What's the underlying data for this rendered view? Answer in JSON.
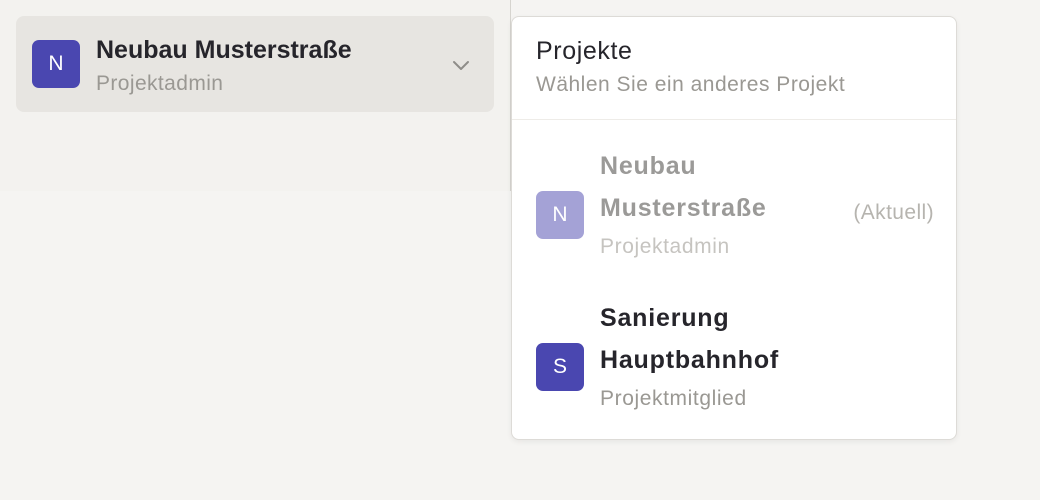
{
  "switcher": {
    "avatar_letter": "N",
    "project_name": "Neubau Musterstraße",
    "role": "Projektadmin",
    "chevron_icon": "chevron-down-icon"
  },
  "dropdown": {
    "title": "Projekte",
    "subtitle": "Wählen Sie ein anderes Projekt",
    "items": [
      {
        "avatar_letter": "N",
        "name": "Neubau Musterstraße",
        "role": "Projektadmin",
        "current_label": "(Aktuell)",
        "is_current": true
      },
      {
        "avatar_letter": "S",
        "name": "Sanierung Hauptbahnhof",
        "role": "Projektmitglied",
        "is_current": false
      }
    ]
  },
  "colors": {
    "accent": "#4a47b0",
    "accent_muted": "#a4a2d6",
    "background": "#f5f4f2",
    "switcher_bg": "#e7e5e1"
  }
}
